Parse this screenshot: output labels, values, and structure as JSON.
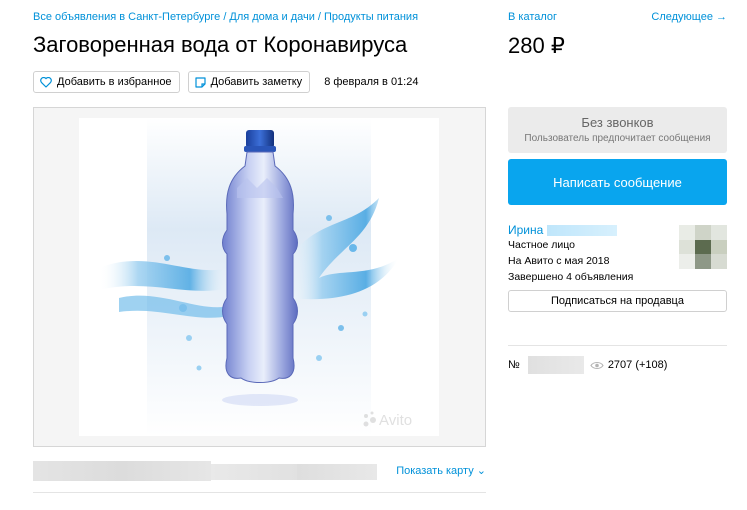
{
  "breadcrumb": {
    "items": [
      "Все объявления в Санкт-Петербурге",
      "Для дома и дачи",
      "Продукты питания"
    ],
    "separator": "/"
  },
  "listing": {
    "title": "Заговоренная вода от Коронавируса",
    "price": "280 ₽",
    "date": "8 февраля в 01:24",
    "favorite_label": "Добавить в избранное",
    "note_label": "Добавить заметку",
    "watermark": "Avito"
  },
  "nav": {
    "catalog_label": "В каталог",
    "next_label": "Следующее →"
  },
  "contact": {
    "no_calls_title": "Без звонков",
    "no_calls_subtitle": "Пользователь предпочитает сообщения",
    "write_button": "Написать сообщение"
  },
  "seller": {
    "name": "Ирина",
    "type": "Частное лицо",
    "since": "На Авито с мая 2018",
    "completed": "Завершено 4 объявления",
    "subscribe_label": "Подписаться на продавца"
  },
  "stats": {
    "number_prefix": "№",
    "views": "2707 (+108)"
  },
  "map": {
    "show_map_label": "Показать карту"
  },
  "colors": {
    "link": "#0091d9",
    "primary_button": "#09a5ee",
    "muted_box": "#ebebeb"
  }
}
